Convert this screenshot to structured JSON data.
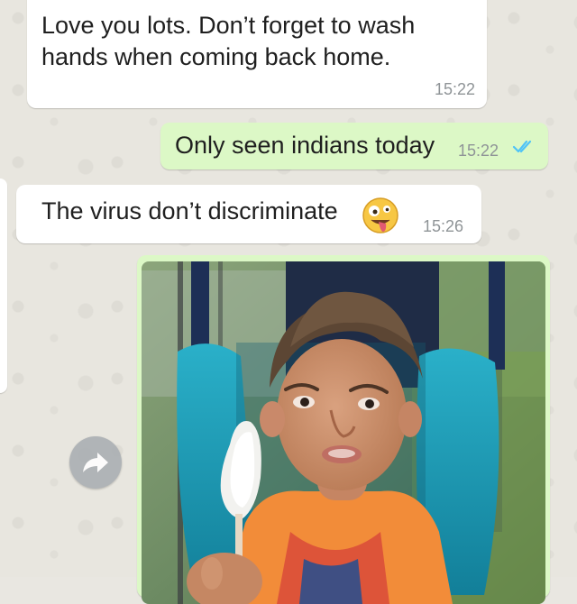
{
  "messages": [
    {
      "text": "Love you lots. Don’t forget to wash hands when coming back home.",
      "time": "15:22",
      "direction": "incoming"
    },
    {
      "text": "Only seen indians today",
      "time": "15:22",
      "direction": "outgoing",
      "status_icon": "double-check-read-icon"
    },
    {
      "text": "The virus don’t discriminate",
      "time": "15:26",
      "direction": "incoming",
      "emoji": "zany-face-emoji"
    },
    {
      "type": "photo",
      "direction": "outgoing",
      "subject": "child eating popsicle in stroller"
    }
  ],
  "forward": {
    "icon": "forward-arrow-icon"
  },
  "colors": {
    "incoming_bubble": "#ffffff",
    "outgoing_bubble": "#dcf8c6",
    "timestamp": "#8f9497",
    "read_ticks": "#4fc3f7",
    "wallpaper": "#e8e6df"
  }
}
